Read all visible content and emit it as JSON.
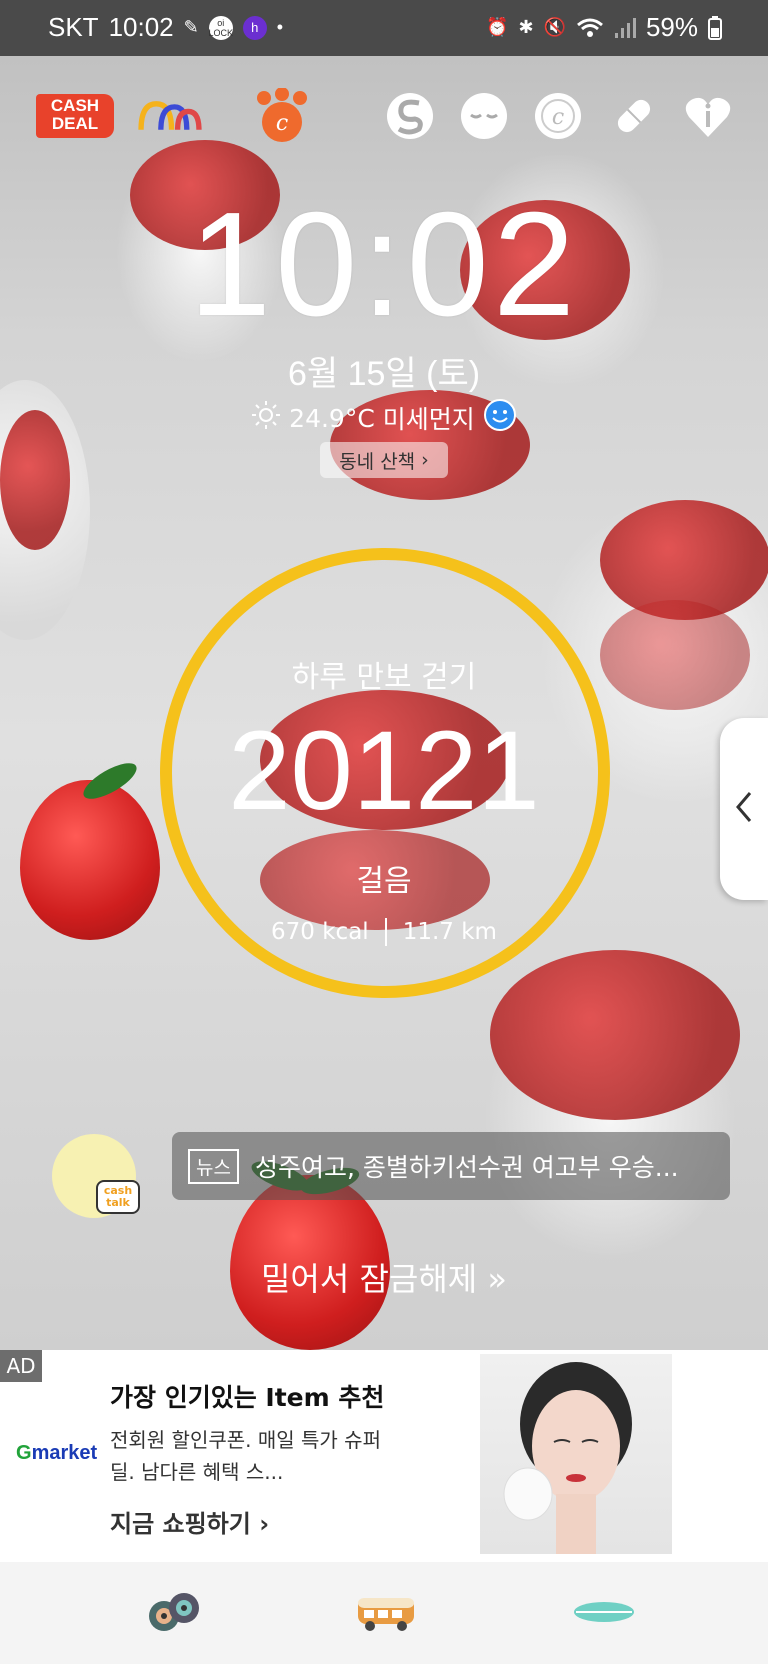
{
  "status_bar": {
    "carrier": "SKT",
    "time": "10:02",
    "lock_badge": "oi LOCK",
    "h_badge": "h",
    "battery": "59%"
  },
  "top_apps": {
    "cash_deal": "CASH DEAL"
  },
  "lockscreen": {
    "clock": "10:02",
    "date": "6월 15일 (토)",
    "temperature": "24.9°C",
    "air_quality_label": "미세먼지",
    "walk_button": "동네 산책"
  },
  "steps_widget": {
    "title": "하루 만보 걷기",
    "count": "20121",
    "unit": "걸음",
    "kcal": "670 kcal",
    "distance": "11.7 km",
    "ring_color": "#f5c11b"
  },
  "cashtalk": {
    "tag": "cash talk"
  },
  "news": {
    "tag": "뉴스",
    "headline": "성주여고, 종별하키선수권 여고부 우승..."
  },
  "unlock_text": "밀어서 잠금해제",
  "ad": {
    "label": "AD",
    "brand": "Gmarket",
    "title": "가장 인기있는 Item 추천",
    "description": "전회원 할인쿠폰. 매일 특가 슈퍼딜. 남다른 혜택 스...",
    "cta": "지금 쇼핑하기"
  },
  "bottom_nav": {
    "items": [
      "camera-reels-icon",
      "van-icon",
      "surfboard-icon"
    ]
  }
}
